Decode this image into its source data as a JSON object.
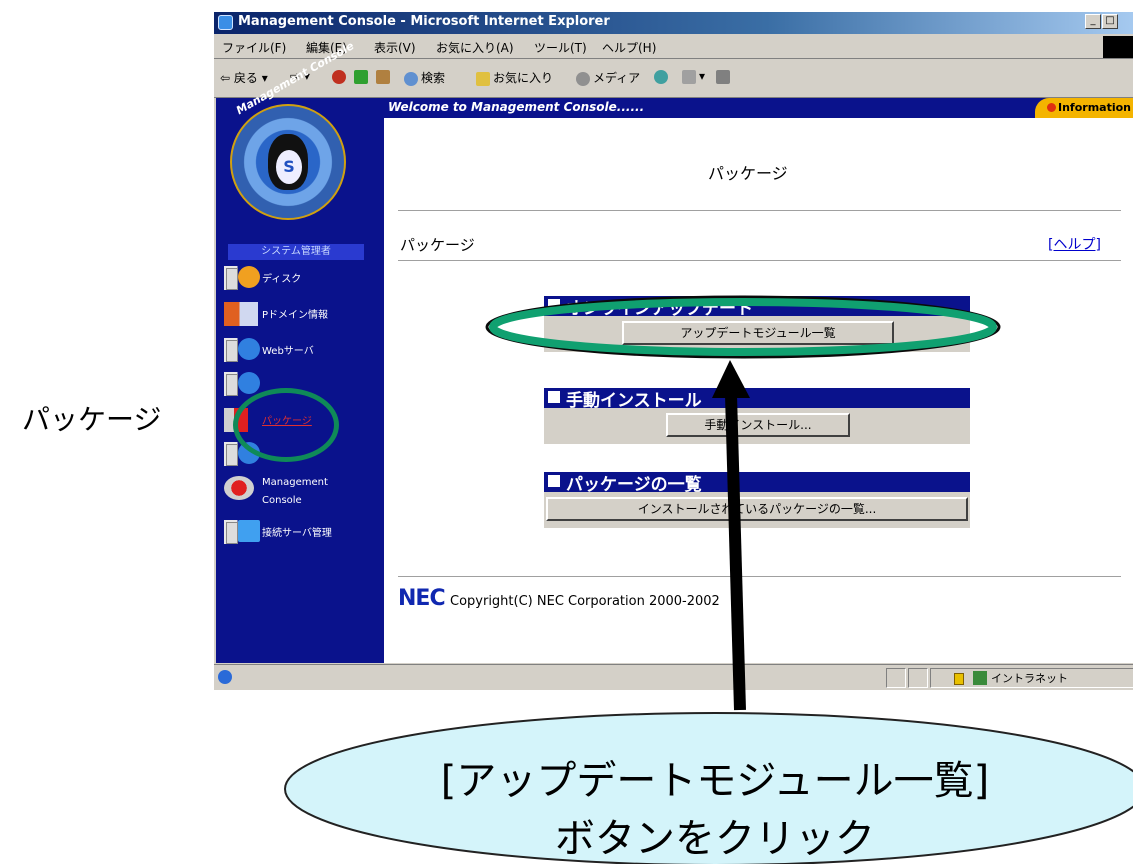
{
  "window": {
    "title": "Management Console - Microsoft Internet Explorer",
    "buttons": [
      "_",
      "□"
    ]
  },
  "menubar": [
    "ファイル(F)",
    "編集(E)",
    "表示(V)",
    "お気に入り(A)",
    "ツール(T)",
    "ヘルプ(H)"
  ],
  "toolbar": {
    "back": "戻る",
    "search": "検索",
    "favorites": "お気に入り",
    "media": "メディア"
  },
  "sidebar": {
    "logo_text": "Management Console",
    "section": "システム管理者",
    "items": [
      {
        "label": "ディスク",
        "icon": "disk-icon"
      },
      {
        "label": "Pドメイン情報",
        "icon": "domain-icon"
      },
      {
        "label": "Webサーバ",
        "icon": "web-server-icon"
      },
      {
        "label": "",
        "icon": "server-icon"
      },
      {
        "label": "パッケージ",
        "icon": "package-icon"
      },
      {
        "label": "",
        "icon": "server-icon"
      },
      {
        "label": "Management Console",
        "icon": "management-console-icon"
      },
      {
        "label": "接続サーバ管理",
        "icon": "connected-server-icon"
      }
    ]
  },
  "content": {
    "welcome": "Welcome to Management Console......",
    "info_tab": "Information",
    "page_heading": "パッケージ",
    "section_title": "パッケージ",
    "help_link": "[ヘルプ]",
    "panels": [
      {
        "title": "オンラインアップデート",
        "button": "アップデートモジュール一覧"
      },
      {
        "title": "手動インストール",
        "button": "手動インストール..."
      },
      {
        "title": "パッケージの一覧",
        "button": "インストールされているパッケージの一覧..."
      }
    ],
    "logo": "NEC",
    "copyright": "Copyright(C) NEC Corporation 2000-2002"
  },
  "statusbar": {
    "zone": "イントラネット"
  },
  "annotations": {
    "package_label": "パッケージ",
    "bubble_line1": "[アップデートモジュール一覧]",
    "bubble_line2": "ボタンをクリック"
  },
  "colors": {
    "navy": "#0a128c",
    "highlight_ring": "#0f8a58",
    "bubble_fill": "#d4f4fa"
  }
}
